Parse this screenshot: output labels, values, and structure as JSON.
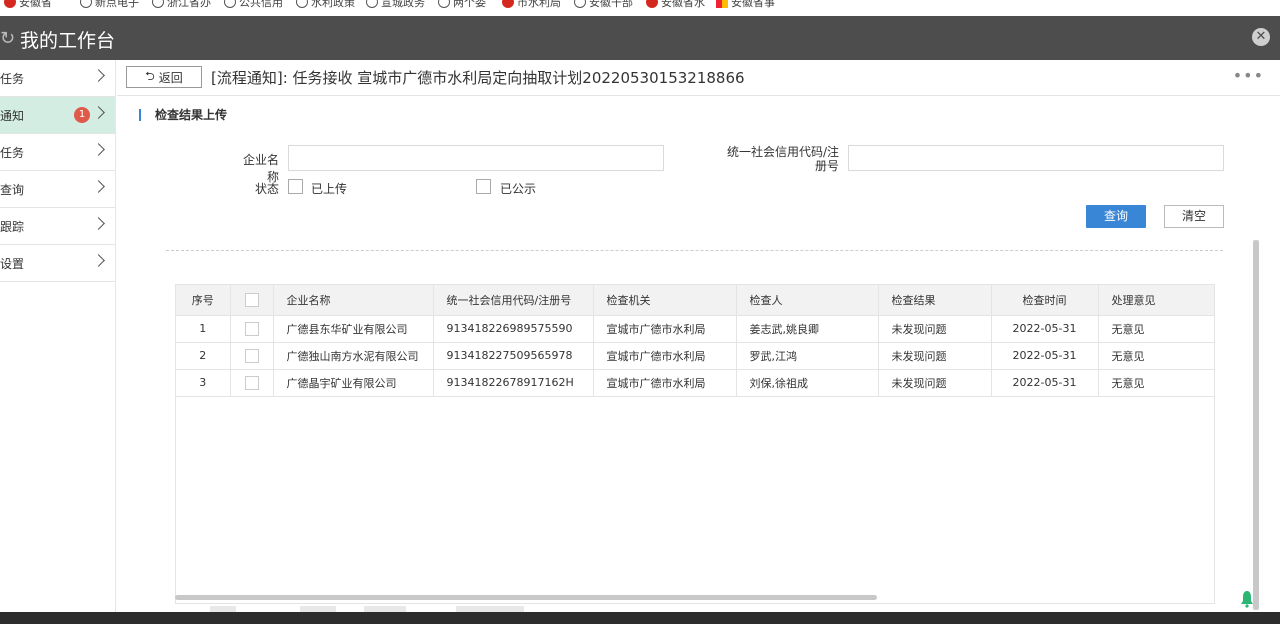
{
  "bookmarks": [
    {
      "label": "安徽省",
      "icon": "emblem-icon"
    },
    {
      "label": "新点电子",
      "icon": "globe-icon"
    },
    {
      "label": "浙江省办",
      "icon": "globe-icon"
    },
    {
      "label": "公共信用",
      "icon": "globe-icon"
    },
    {
      "label": "水利政策",
      "icon": "globe-icon"
    },
    {
      "label": "宣城政务",
      "icon": "globe-icon"
    },
    {
      "label": "两个委",
      "icon": "globe-icon"
    },
    {
      "label": "市水利局",
      "icon": "emblem-icon"
    },
    {
      "label": "安徽干部",
      "icon": "globe-icon"
    },
    {
      "label": "安徽省水",
      "icon": "emblem-icon"
    },
    {
      "label": "安徽省事",
      "icon": "tile-icon"
    }
  ],
  "window": {
    "title": "我的工作台",
    "close_symbol": "✕",
    "refresh_symbol": "↻"
  },
  "sidebar": {
    "items": [
      {
        "label": "任务",
        "badge": ""
      },
      {
        "label": "通知",
        "badge": "1"
      },
      {
        "label": "任务",
        "badge": ""
      },
      {
        "label": "查询",
        "badge": ""
      },
      {
        "label": "跟踪",
        "badge": ""
      },
      {
        "label": "设置",
        "badge": ""
      }
    ],
    "active_index": 1
  },
  "topbar": {
    "back_label": "返回",
    "back_symbol": "⮌",
    "title": "[流程通知]: 任务接收 宣城市广德市水利局定向抽取计划20220530153218866",
    "more_symbol": "•••"
  },
  "section": {
    "title": "检查结果上传"
  },
  "search_form": {
    "company_label": "企业名称",
    "company_value": "",
    "credit_label_line1": "统一社会信用代码/注",
    "credit_label_line2": "册号",
    "credit_value": "",
    "status_label": "状态",
    "status_options": [
      "已上传",
      "已公示"
    ],
    "query_button": "查询",
    "clear_button": "清空"
  },
  "table": {
    "columns": [
      "序号",
      "",
      "企业名称",
      "统一社会信用代码/注册号",
      "检查机关",
      "检查人",
      "检查结果",
      "检查时间",
      "处理意见"
    ],
    "rows": [
      {
        "seq": "1",
        "company": "广德县东华矿业有限公司",
        "code": "913418226989575590",
        "authority": "宣城市广德市水利局",
        "inspectors": "姜志武,姚良卿",
        "result": "未发现问题",
        "date": "2022-05-31",
        "opinion": "无意见"
      },
      {
        "seq": "2",
        "company": "广德独山南方水泥有限公司",
        "code": "913418227509565978",
        "authority": "宣城市广德市水利局",
        "inspectors": "罗武,江鸿",
        "result": "未发现问题",
        "date": "2022-05-31",
        "opinion": "无意见"
      },
      {
        "seq": "3",
        "company": "广德晶宇矿业有限公司",
        "code": "91341822678917162H",
        "authority": "宣城市广德市水利局",
        "inspectors": "刘保,徐祖成",
        "result": "未发现问题",
        "date": "2022-05-31",
        "opinion": "无意见"
      }
    ]
  },
  "colors": {
    "titlebar": "#4d4d4d",
    "accent": "#3a86d6",
    "active_nav": "#d4ede3",
    "badge": "#e05a4a"
  }
}
